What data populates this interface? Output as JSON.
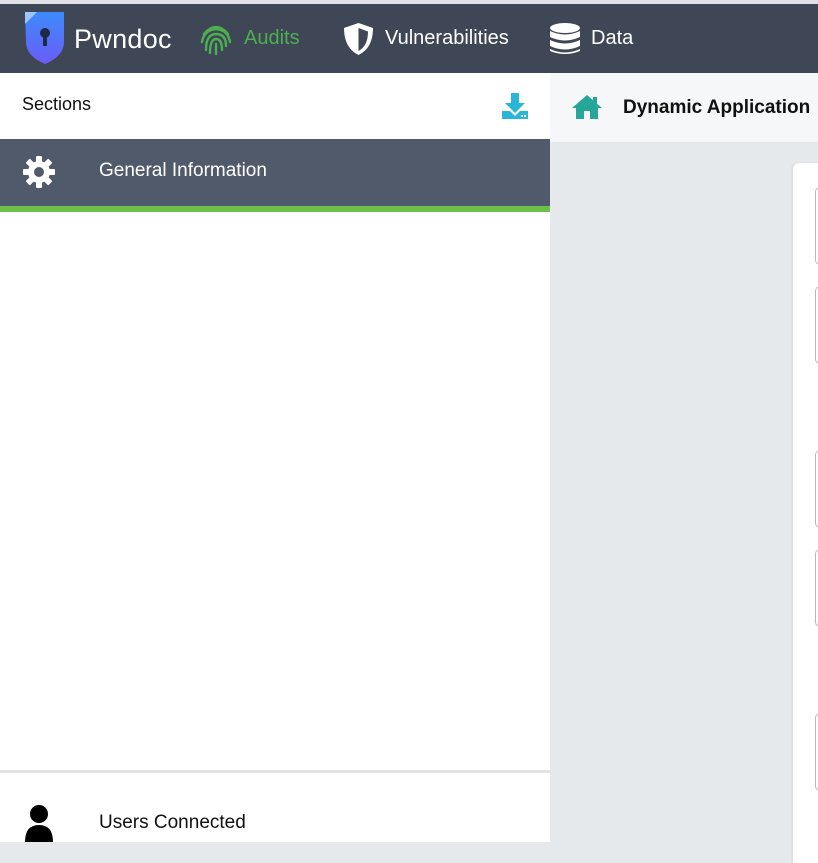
{
  "app": {
    "name": "Pwndoc"
  },
  "nav": {
    "items": [
      {
        "label": "Audits",
        "icon": "fingerprint-icon",
        "active": true
      },
      {
        "label": "Vulnerabilities",
        "icon": "shield-icon",
        "active": false
      },
      {
        "label": "Data",
        "icon": "database-icon",
        "active": false
      }
    ]
  },
  "sidebar": {
    "title": "Sections",
    "download_icon": "download-icon",
    "items": [
      {
        "label": "General Information",
        "icon": "gear-icon"
      }
    ],
    "footer": {
      "label": "Users Connected",
      "icon": "person-icon"
    }
  },
  "header": {
    "title": "Dynamic Application",
    "home_icon": "home-icon"
  },
  "colors": {
    "navbar": "#3f4756",
    "active_nav": "#4caf50",
    "section_selected": "#515a6b",
    "accent_bar": "#6cc04a",
    "download": "#29b6d8",
    "home": "#26a69a"
  }
}
